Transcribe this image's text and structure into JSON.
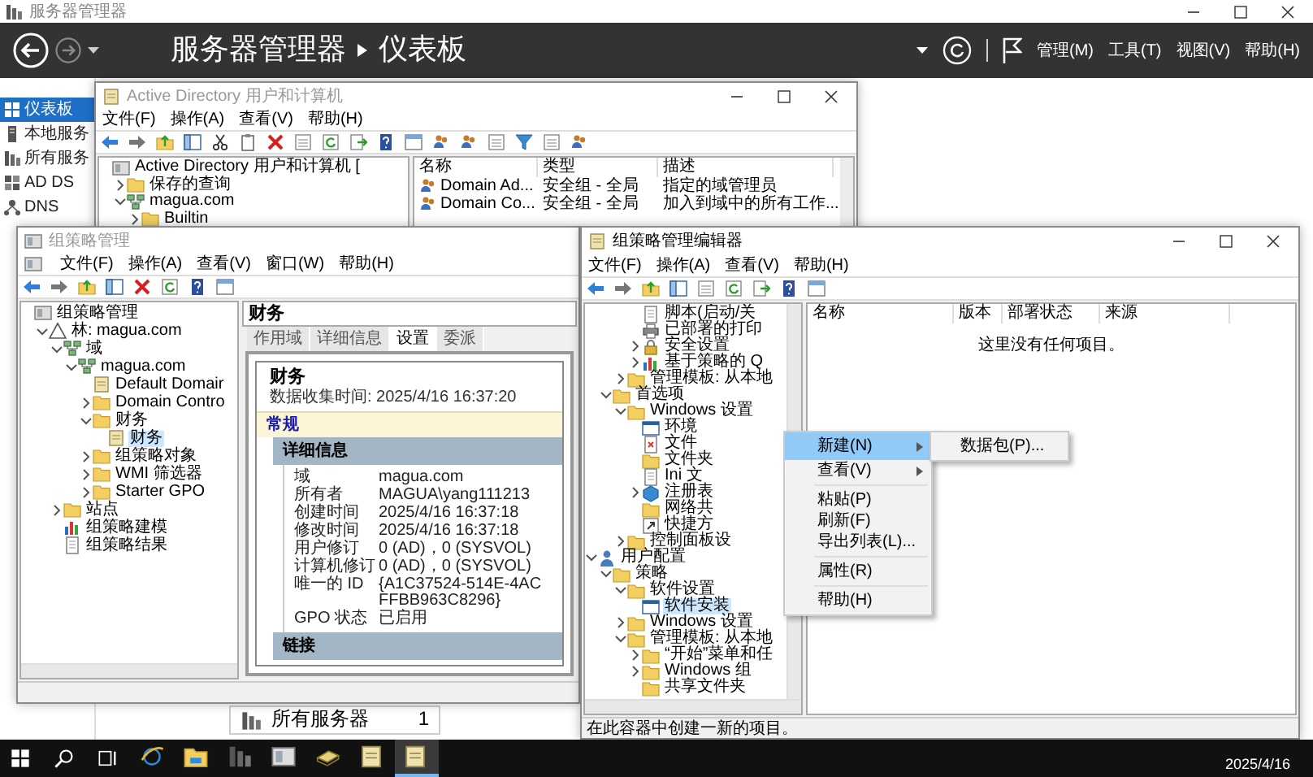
{
  "server_manager": {
    "title": "服务器管理器",
    "breadcrumb": {
      "app": "服务器管理器",
      "page": "仪表板"
    },
    "menu": [
      "管理(M)",
      "工具(T)",
      "视图(V)",
      "帮助(H)"
    ],
    "nav": [
      {
        "label": "仪表板",
        "kind": "dashboard",
        "selected": true
      },
      {
        "label": "本地服务",
        "kind": "server",
        "selected": false
      },
      {
        "label": "所有服务",
        "kind": "servers",
        "selected": false
      },
      {
        "label": "AD DS",
        "kind": "addirectory",
        "selected": false
      },
      {
        "label": "DNS",
        "kind": "dns",
        "selected": false
      }
    ],
    "tile": {
      "label": "所有服务器",
      "count": "1"
    }
  },
  "ad_window": {
    "title": "Active Directory 用户和计算机",
    "menu": [
      "文件(F)",
      "操作(A)",
      "查看(V)",
      "帮助(H)"
    ],
    "tree": [
      {
        "label": "Active Directory 用户和计算机 [",
        "kind": "console",
        "selected": false,
        "children": [
          {
            "label": "保存的查询",
            "kind": "folder",
            "expanded": false,
            "selected": false
          },
          {
            "label": "magua.com",
            "kind": "domain",
            "expanded": true,
            "selected": false,
            "children": [
              {
                "label": "Builtin",
                "kind": "folder",
                "expanded": false,
                "selected": false
              }
            ]
          }
        ]
      }
    ],
    "columns": [
      "名称",
      "类型",
      "描述"
    ],
    "rows": [
      [
        "Domain Ad...",
        "安全组 - 全局",
        "指定的域管理员"
      ],
      [
        "Domain Co...",
        "安全组 - 全局",
        "加入到域中的所有工作..."
      ]
    ]
  },
  "gpmc_window": {
    "title": "组策略管理",
    "menu": [
      "文件(F)",
      "操作(A)",
      "查看(V)",
      "窗口(W)",
      "帮助(H)"
    ],
    "tree": [
      {
        "label": "组策略管理",
        "kind": "console",
        "selected": false,
        "children": [
          {
            "label": "林: magua.com",
            "kind": "forest",
            "expanded": true,
            "selected": false,
            "children": [
              {
                "label": "域",
                "kind": "domain",
                "expanded": true,
                "selected": false,
                "children": [
                  {
                    "label": "magua.com",
                    "kind": "domain",
                    "expanded": true,
                    "selected": false,
                    "children": [
                      {
                        "label": "Default Domair",
                        "kind": "gpo",
                        "selected": false
                      },
                      {
                        "label": "Domain Contro",
                        "kind": "folder",
                        "expanded": false,
                        "selected": false
                      },
                      {
                        "label": "财务",
                        "kind": "folder",
                        "expanded": true,
                        "selected": false,
                        "children": [
                          {
                            "label": "财务",
                            "kind": "gpo",
                            "selected": true
                          }
                        ]
                      },
                      {
                        "label": "组策略对象",
                        "kind": "folder",
                        "expanded": false,
                        "selected": false
                      },
                      {
                        "label": "WMI 筛选器",
                        "kind": "folder",
                        "expanded": false,
                        "selected": false
                      },
                      {
                        "label": "Starter GPO",
                        "kind": "folder",
                        "expanded": false,
                        "selected": false
                      }
                    ]
                  }
                ]
              },
              {
                "label": "站点",
                "kind": "folder",
                "expanded": false,
                "selected": false
              },
              {
                "label": "组策略建模",
                "kind": "chart",
                "selected": false
              },
              {
                "label": "组策略结果",
                "kind": "doc",
                "selected": false
              }
            ]
          }
        ]
      }
    ],
    "report": {
      "heading": "财务",
      "tabs": [
        {
          "label": "作用域",
          "selected": false
        },
        {
          "label": "详细信息",
          "selected": false
        },
        {
          "label": "设置",
          "selected": true
        },
        {
          "label": "委派",
          "selected": false
        }
      ],
      "title": "财务",
      "collected": "数据收集时间: 2025/4/16 16:37:20",
      "general": "常规",
      "sections": [
        {
          "title": "详细信息",
          "props": [
            [
              "域",
              "magua.com"
            ],
            [
              "所有者",
              "MAGUA\\yang111213"
            ],
            [
              "创建时间",
              "2025/4/16 16:37:18"
            ],
            [
              "修改时间",
              "2025/4/16 16:37:18"
            ],
            [
              "用户修订",
              "0 (AD)，0 (SYSVOL)"
            ],
            [
              "计算机修订",
              "0 (AD)，0 (SYSVOL)"
            ],
            [
              "唯一的 ID",
              "{A1C37524-514E-4AC\nFFBB963C8296}"
            ],
            [
              "GPO 状态",
              "已启用"
            ]
          ]
        },
        {
          "title": "链接"
        }
      ]
    }
  },
  "editor_window": {
    "title": "组策略管理编辑器",
    "menu": [
      "文件(F)",
      "操作(A)",
      "查看(V)",
      "帮助(H)"
    ],
    "tree": [
      {
        "children": [
          {
            "children": [
              {
                "children": [
                  {
                    "label": "脚本(启动/关",
                    "kind": "doc",
                    "selected": false
                  },
                  {
                    "label": "已部署的打印",
                    "kind": "printer",
                    "selected": false
                  },
                  {
                    "label": "安全设置",
                    "kind": "security",
                    "expanded": false,
                    "selected": false
                  },
                  {
                    "label": "基于策略的 Q",
                    "kind": "chart",
                    "expanded": false,
                    "selected": false
                  }
                ]
              },
              {
                "label": "管理模板: 从本地",
                "kind": "folder",
                "expanded": false,
                "selected": false
              }
            ]
          },
          {
            "label": "首选项",
            "kind": "folder",
            "expanded": true,
            "selected": false,
            "children": [
              {
                "label": "Windows 设置",
                "kind": "folder",
                "expanded": true,
                "selected": false,
                "children": [
                  {
                    "label": "环境",
                    "kind": "window",
                    "selected": false
                  },
                  {
                    "label": "文件",
                    "kind": "file",
                    "selected": false
                  },
                  {
                    "label": "文件夹",
                    "kind": "folder",
                    "selected": false
                  },
                  {
                    "label": "Ini 文",
                    "kind": "doc",
                    "selected": false
                  },
                  {
                    "label": "注册表",
                    "kind": "registry",
                    "expanded": false,
                    "selected": false
                  },
                  {
                    "label": "网络共",
                    "kind": "folder",
                    "selected": false
                  },
                  {
                    "label": "快捷方",
                    "kind": "shortcut",
                    "selected": false
                  }
                ]
              },
              {
                "label": "控制面板设",
                "kind": "folder",
                "expanded": false,
                "selected": false
              }
            ]
          }
        ]
      },
      {
        "label": "用户配置",
        "kind": "user",
        "expanded": true,
        "selected": false,
        "children": [
          {
            "label": "策略",
            "kind": "folder",
            "expanded": true,
            "selected": false,
            "children": [
              {
                "label": "软件设置",
                "kind": "folder",
                "expanded": true,
                "selected": false,
                "children": [
                  {
                    "label": "软件安装",
                    "kind": "window",
                    "selected": true
                  }
                ]
              },
              {
                "label": "Windows 设置",
                "kind": "folder",
                "expanded": false,
                "selected": false
              },
              {
                "label": "管理模板: 从本地",
                "kind": "folder",
                "expanded": true,
                "selected": false,
                "children": [
                  {
                    "label": "“开始”菜单和任",
                    "kind": "folder",
                    "expanded": false,
                    "selected": false
                  },
                  {
                    "label": "Windows 组",
                    "kind": "folder",
                    "expanded": false,
                    "selected": false
                  },
                  {
                    "label": "共享文件夹",
                    "kind": "folder",
                    "selected": false
                  }
                ]
              }
            ]
          }
        ]
      }
    ],
    "columns": [
      "名称",
      "版本",
      "部署状态",
      "来源"
    ],
    "empty": "这里没有任何项目。",
    "status": "在此容器中创建一新的项目。"
  },
  "context_menu": {
    "groups": [
      [
        {
          "label": "新建(N)",
          "submenu": true,
          "selected": true
        },
        {
          "label": "查看(V)",
          "submenu": true,
          "selected": false
        }
      ],
      [
        {
          "label": "粘贴(P)",
          "submenu": false,
          "selected": false
        },
        {
          "label": "刷新(F)",
          "submenu": false,
          "selected": false
        },
        {
          "label": "导出列表(L)...",
          "submenu": false,
          "selected": false
        }
      ],
      [
        {
          "label": "属性(R)",
          "submenu": false,
          "selected": false
        }
      ],
      [
        {
          "label": "帮助(H)",
          "submenu": false,
          "selected": false
        }
      ]
    ],
    "submenu": [
      {
        "label": "数据包(P)...",
        "selected": false
      }
    ]
  },
  "taskbar": {
    "apps": [
      {
        "kind": "browser",
        "selected": false
      },
      {
        "kind": "explorer",
        "selected": false
      },
      {
        "kind": "server",
        "selected": false
      },
      {
        "kind": "console",
        "selected": false
      },
      {
        "kind": "book",
        "selected": false
      },
      {
        "kind": "scroll",
        "selected": false
      },
      {
        "kind": "scroll",
        "selected": true
      }
    ],
    "date": "2025/4/16"
  }
}
